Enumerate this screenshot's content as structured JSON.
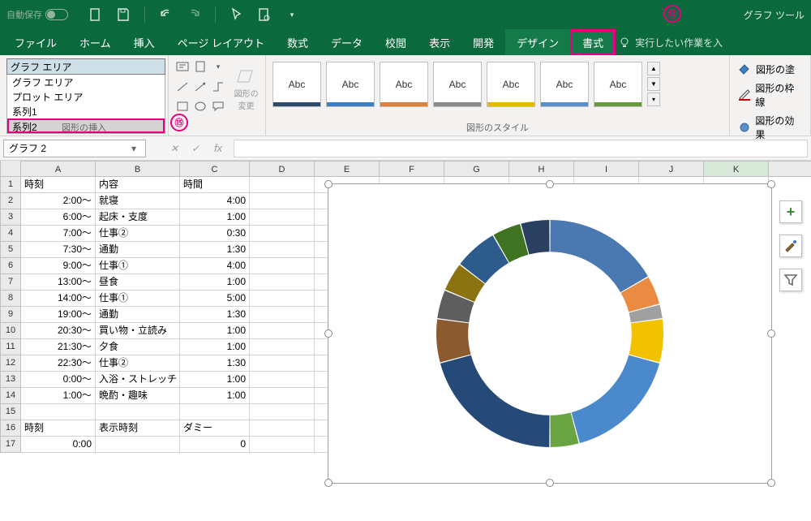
{
  "titlebar": {
    "autosave_label": "自動保存",
    "autosave_state": "オフ",
    "graph_tools": "グラフ ツール"
  },
  "tabs": [
    "ファイル",
    "ホーム",
    "挿入",
    "ページ レイアウト",
    "数式",
    "データ",
    "校閲",
    "表示",
    "開発",
    "デザイン",
    "書式"
  ],
  "tell_me": "実行したい作業を入",
  "ribbon": {
    "selection_value": "グラフ エリア",
    "selection_list": [
      "グラフ エリア",
      "プロット エリア",
      "系列1",
      "系列2"
    ],
    "shapes_change": "図形の\n変更",
    "group_insert": "図形の挿入",
    "group_styles": "図形のスタイル",
    "style_label": "Abc",
    "fill": "図形の塗",
    "outline": "図形の枠線",
    "effects": "図形の効果"
  },
  "callouts": {
    "c14": "⑭",
    "c15": "⑮"
  },
  "namebox": "グラフ 2",
  "columns": {
    "A": 92,
    "B": 104,
    "C": 86,
    "D": 80,
    "E": 80,
    "F": 80,
    "G": 80,
    "H": 80,
    "I": 80,
    "J": 80,
    "K": 80
  },
  "headers": {
    "A": "時刻",
    "B": "内容",
    "C": "時間"
  },
  "headers2": {
    "A": "時刻",
    "B": "表示時刻",
    "C": "ダミー"
  },
  "rows": [
    {
      "a": "2:00～",
      "b": "就寝",
      "c": "4:00"
    },
    {
      "a": "6:00～",
      "b": "起床・支度",
      "c": "1:00"
    },
    {
      "a": "7:00～",
      "b": "仕事②",
      "c": "0:30"
    },
    {
      "a": "7:30～",
      "b": "通勤",
      "c": "1:30"
    },
    {
      "a": "9:00～",
      "b": "仕事①",
      "c": "4:00"
    },
    {
      "a": "13:00～",
      "b": "昼食",
      "c": "1:00"
    },
    {
      "a": "14:00～",
      "b": "仕事①",
      "c": "5:00"
    },
    {
      "a": "19:00～",
      "b": "通勤",
      "c": "1:30"
    },
    {
      "a": "20:30～",
      "b": "買い物・立読み",
      "c": "1:00"
    },
    {
      "a": "21:30～",
      "b": "夕食",
      "c": "1:00"
    },
    {
      "a": "22:30～",
      "b": "仕事②",
      "c": "1:30"
    },
    {
      "a": "0:00～",
      "b": "入浴・ストレッチ",
      "c": "1:00"
    },
    {
      "a": "1:00～",
      "b": "晩酌・趣味",
      "c": "1:00"
    }
  ],
  "row17": {
    "a": "0:00",
    "c": "0"
  },
  "chart_data": {
    "type": "pie",
    "subtype": "doughnut",
    "categories": [
      "就寝",
      "起床・支度",
      "仕事②",
      "通勤",
      "仕事①",
      "昼食",
      "仕事①",
      "通勤",
      "買い物・立読み",
      "夕食",
      "仕事②",
      "入浴・ストレッチ",
      "晩酌・趣味"
    ],
    "values": [
      4.0,
      1.0,
      0.5,
      1.5,
      4.0,
      1.0,
      5.0,
      1.5,
      1.0,
      1.0,
      1.5,
      1.0,
      1.0
    ],
    "colors": [
      "#4a78b0",
      "#ea8b44",
      "#a0a0a0",
      "#f2c200",
      "#4a8acc",
      "#6aa342",
      "#264a77",
      "#8b5a2e",
      "#5e5e5e",
      "#8a7310",
      "#2d5c8c",
      "#3f7322",
      "#2a4060"
    ],
    "hole_ratio": 0.72,
    "title": "",
    "legend": false
  }
}
